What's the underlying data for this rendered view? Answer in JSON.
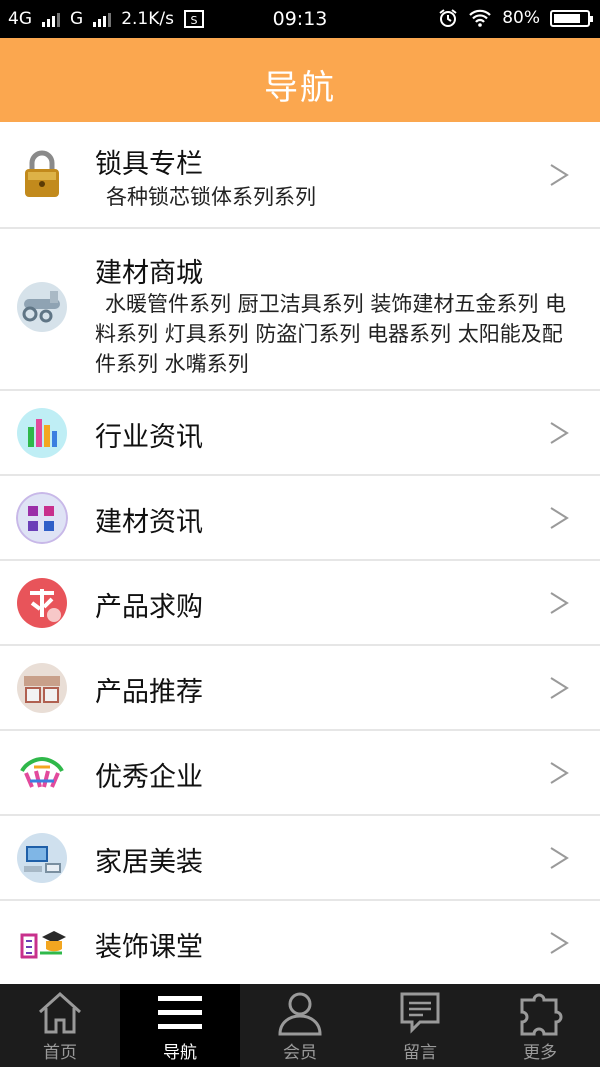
{
  "status_bar": {
    "network1": "4G",
    "network2": "G",
    "speed": "2.1K/s",
    "time": "09:13",
    "battery_text": "80%",
    "battery_level": 0.8
  },
  "header": {
    "title": "导航"
  },
  "menu": [
    {
      "label": "锁具专栏",
      "sub": "各种锁芯锁体系列系列",
      "icon": "lock-icon"
    },
    {
      "label": "建材商城",
      "sub": "水暖管件系列 厨卫洁具系列 装饰建材五金系列 电料系列 灯具系列 防盗门系列 电器系列 太阳能及配件系列 水嘴系列",
      "icon": "building-materials-icon"
    },
    {
      "label": "行业资讯",
      "icon": "industry-news-icon"
    },
    {
      "label": "建材资讯",
      "icon": "building-news-icon"
    },
    {
      "label": "产品求购",
      "icon": "purchase-request-icon"
    },
    {
      "label": "产品推荐",
      "icon": "product-recommend-icon"
    },
    {
      "label": "优秀企业",
      "icon": "excellent-enterprise-icon"
    },
    {
      "label": "家居美装",
      "icon": "home-decor-icon"
    },
    {
      "label": "装饰课堂",
      "icon": "decoration-class-icon"
    }
  ],
  "tabs": [
    {
      "label": "首页",
      "icon": "home-icon",
      "active": false
    },
    {
      "label": "导航",
      "icon": "menu-icon",
      "active": true
    },
    {
      "label": "会员",
      "icon": "user-icon",
      "active": false
    },
    {
      "label": "留言",
      "icon": "message-icon",
      "active": false
    },
    {
      "label": "更多",
      "icon": "puzzle-icon",
      "active": false
    }
  ],
  "colors": {
    "header": "#fba74f",
    "tabbar": "#1c1c1c",
    "tab_active": "#000000"
  }
}
